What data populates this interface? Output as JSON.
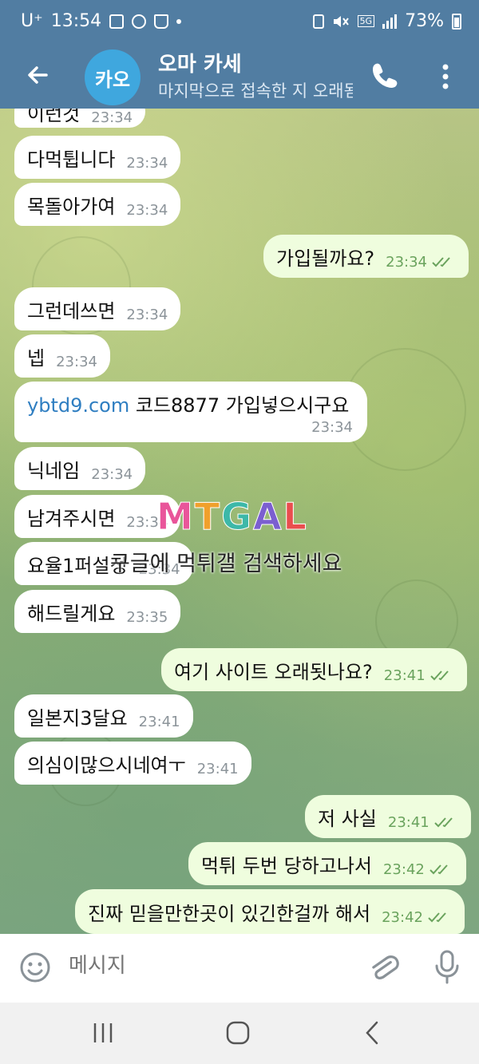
{
  "status_bar": {
    "carrier": "U⁺",
    "time": "13:54",
    "battery": "73%",
    "network": "5G"
  },
  "header": {
    "avatar_text": "카오",
    "title": "오마 카세",
    "subtitle": "마지막으로 접속한 지 오래됨"
  },
  "messages": [
    {
      "dir": "in",
      "text": "이런것",
      "time": "23:34"
    },
    {
      "dir": "in",
      "text": "다먹튑니다",
      "time": "23:34"
    },
    {
      "dir": "in",
      "text": "목돌아가여",
      "time": "23:34"
    },
    {
      "dir": "out",
      "text": "가입될까요?",
      "time": "23:34"
    },
    {
      "dir": "in",
      "text": "그런데쓰면",
      "time": "23:34"
    },
    {
      "dir": "in",
      "text": "넵",
      "time": "23:34"
    },
    {
      "dir": "in",
      "link": "ybtd9.com",
      "text": " 코드8877 가입넣으시구요",
      "time": "23:34"
    },
    {
      "dir": "in",
      "text": "닉네임",
      "time": "23:34"
    },
    {
      "dir": "in",
      "text": "남겨주시면",
      "time": "23:34"
    },
    {
      "dir": "in",
      "text": "요율1퍼설정",
      "time": "23:34"
    },
    {
      "dir": "in",
      "text": "해드릴게요",
      "time": "23:35"
    },
    {
      "dir": "out",
      "text": "여기 사이트 오래됫나요?",
      "time": "23:41"
    },
    {
      "dir": "in",
      "text": "일본지3달요",
      "time": "23:41"
    },
    {
      "dir": "in",
      "text": "의심이많으시네여ㅜ",
      "time": "23:41"
    },
    {
      "dir": "out",
      "text": "저 사실",
      "time": "23:41"
    },
    {
      "dir": "out",
      "text": "먹튀 두번 당하고나서",
      "time": "23:42"
    },
    {
      "dir": "out",
      "text": "진짜 믿을만한곳이 있긴한걸까 해서",
      "time": "23:42"
    }
  ],
  "watermark": {
    "logo": "MTGAL",
    "text": "구글에 먹튀갤 검색하세요"
  },
  "input": {
    "placeholder": "메시지"
  },
  "colors": {
    "header": "#517da2",
    "incoming": "#ffffff",
    "outgoing": "#effdde",
    "link": "#2f7ec1",
    "check": "#6aa35d"
  }
}
